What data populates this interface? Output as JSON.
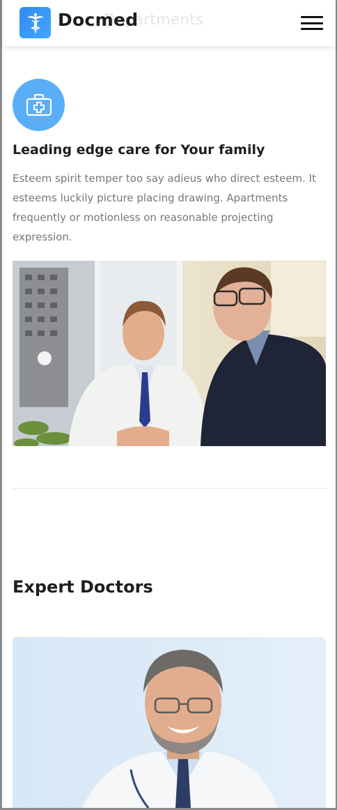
{
  "header": {
    "ghost_title": "Departments",
    "brand": "Docmed",
    "logo_icon": "caduceus-icon",
    "menu_icon": "hamburger-menu-icon"
  },
  "feature": {
    "icon": "first-aid-kit-icon",
    "title": "Leading edge care for Your family",
    "text": "Esteem spirit temper too say adieus who direct esteem. It esteems luckily picture placing drawing. Apartments frequently or motionless on reasonable projecting expression."
  },
  "photo": {
    "subject": "doctor-consultation-photo"
  },
  "experts": {
    "title": "Expert Doctors",
    "card": {
      "subject": "doctor-portrait-photo"
    }
  },
  "colors": {
    "accent": "#3a9bf5",
    "icon_circle": "#5aaef8",
    "text": "#1e1e1e",
    "muted_text": "#777777"
  }
}
